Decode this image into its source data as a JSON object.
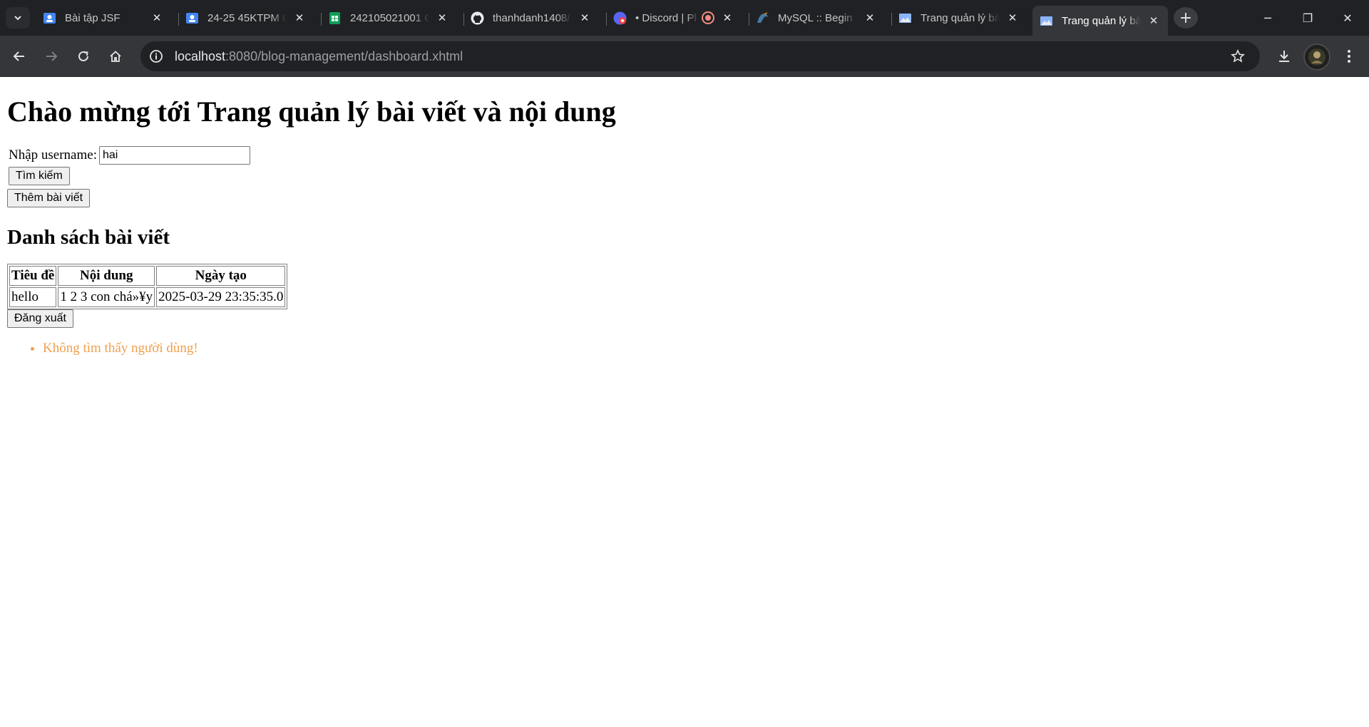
{
  "browser": {
    "tabs": [
      {
        "title": "Bài tập JSF",
        "icon": "google-classroom-icon",
        "active": false
      },
      {
        "title": "24-25 45KTPM C",
        "icon": "google-classroom-icon",
        "active": false
      },
      {
        "title": "242105021001 C",
        "icon": "google-sheets-icon",
        "active": false
      },
      {
        "title": "thanhdanh1408/",
        "icon": "github-icon",
        "active": false
      },
      {
        "title": "• Discord | Pl",
        "icon": "discord-icon",
        "active": false
      },
      {
        "title": "MySQL :: Begin Y",
        "icon": "mysql-icon",
        "active": false
      },
      {
        "title": "Trang quản lý bà",
        "icon": "page-icon",
        "active": false
      },
      {
        "title": "Trang quản lý bà",
        "icon": "page-icon",
        "active": true
      }
    ],
    "url_host": "localhost",
    "url_rest": ":8080/blog-management/dashboard.xhtml"
  },
  "page": {
    "heading": "Chào mừng tới Trang quản lý bài viết và nội dung",
    "search": {
      "label": "Nhập username:",
      "value": "hai",
      "button": "Tìm kiếm"
    },
    "add_button": "Thêm bài viết",
    "list_heading": "Danh sách bài viết",
    "table": {
      "headers": [
        "Tiêu đề",
        "Nội dung",
        "Ngày tạo"
      ],
      "rows": [
        [
          "hello",
          "1 2 3 con chá»¥y",
          "2025-03-29 23:35:35.0"
        ]
      ]
    },
    "logout_button": "Đăng xuất",
    "messages": [
      "Không tìm thấy người dùng!"
    ],
    "message_color": "#f0a050"
  }
}
